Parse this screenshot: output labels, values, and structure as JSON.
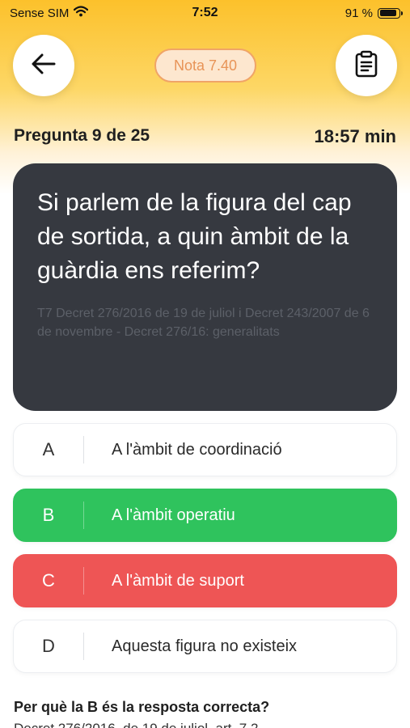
{
  "status_bar": {
    "carrier": "Sense SIM",
    "time": "7:52",
    "battery_percent": "91 %",
    "battery_level": 0.91
  },
  "header": {
    "back_icon": "arrow-left-icon",
    "grade_label": "Nota 7.40",
    "notes_icon": "clipboard-icon"
  },
  "progress": {
    "counter": "Pregunta 9 de 25",
    "timer": "18:57 min"
  },
  "question": {
    "text": "Si parlem de la figura del cap de sortida, a quin àmbit de la guàrdia ens referim?",
    "source": "T7 Decret 276/2016 de 19 de juliol i Decret 243/2007 de 6 de novembre - Decret 276/16: generalitats"
  },
  "answers": [
    {
      "letter": "A",
      "text": "A l'àmbit de coordinació",
      "state": "neutral"
    },
    {
      "letter": "B",
      "text": "A l'àmbit operatiu",
      "state": "correct"
    },
    {
      "letter": "C",
      "text": "A l'àmbit de suport",
      "state": "wrong"
    },
    {
      "letter": "D",
      "text": "Aquesta figura no existeix",
      "state": "neutral"
    }
  ],
  "explanation": {
    "title": "Per què la B és la resposta correcta?",
    "body": "Decret 276/2016, de 19 de juliol, art. 7.2"
  },
  "colors": {
    "header_gradient_top": "#fcc12b",
    "card_dark": "#363940",
    "correct": "#2fc35d",
    "wrong": "#ee5555",
    "grade_border": "#f0a467"
  }
}
